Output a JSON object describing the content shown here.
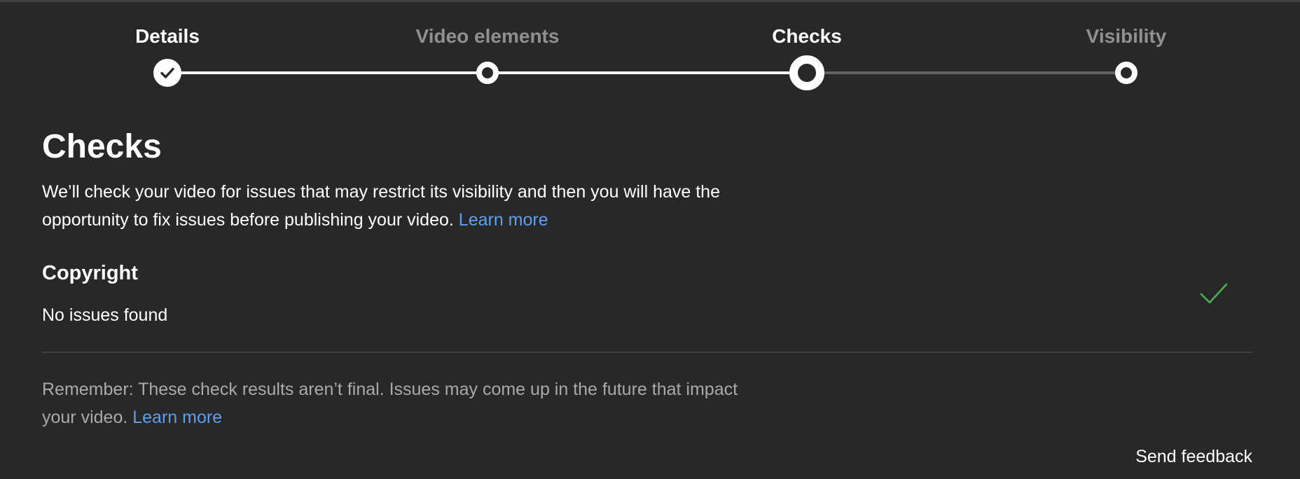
{
  "stepper": {
    "steps": [
      {
        "label": "Details",
        "state": "done"
      },
      {
        "label": "Video elements",
        "state": "visited"
      },
      {
        "label": "Checks",
        "state": "current"
      },
      {
        "label": "Visibility",
        "state": "upcoming"
      }
    ]
  },
  "main": {
    "title": "Checks",
    "description": "We’ll check your video for issues that may restrict its visibility and then you will have the opportunity to fix issues before publishing your video.",
    "description_link": "Learn more",
    "copyright": {
      "title": "Copyright",
      "status": "No issues found",
      "status_icon": "checkmark-icon",
      "status_color": "#4caf50"
    },
    "reminder": "Remember: These check results aren’t final. Issues may come up in the future that impact your video.",
    "reminder_link": "Learn more"
  },
  "footer": {
    "feedback_label": "Send feedback"
  },
  "colors": {
    "background": "#282828",
    "link": "#5e9ff0",
    "track_done": "#ffffff",
    "track_todo": "#606060",
    "muted_text": "#aaaaaa",
    "inactive_step": "#909090"
  }
}
